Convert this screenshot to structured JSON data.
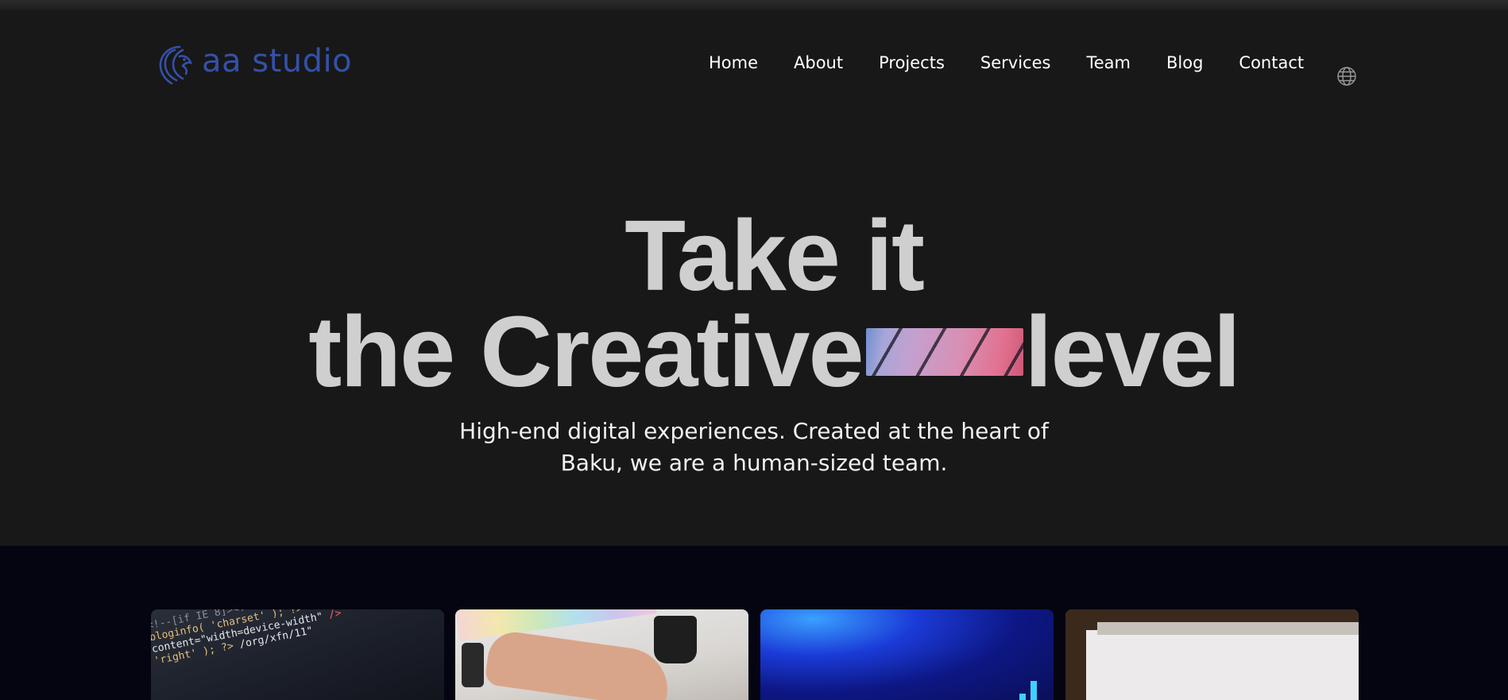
{
  "brand": {
    "name": "aa studio",
    "color": "#3550a8"
  },
  "nav": {
    "items": [
      "Home",
      "About",
      "Projects",
      "Services",
      "Team",
      "Blog",
      "Contact"
    ],
    "language_icon": "globe-icon"
  },
  "hero": {
    "headline_line1": "Take it",
    "headline_line2_left": "the Creative",
    "headline_line2_right": "level",
    "subtitle_line1": "High-end digital experiences. Created at the heart of",
    "subtitle_line2": "Baku, we are a human-sized team."
  },
  "cards": [
    {
      "name": "code-editor-image"
    },
    {
      "name": "designer-desk-image"
    },
    {
      "name": "blue-data-chart-image"
    },
    {
      "name": "window-frame-image"
    }
  ],
  "colors": {
    "background": "#181818",
    "cards_section": "#050512",
    "headline": "#cfcfcf",
    "text": "#ffffff"
  }
}
